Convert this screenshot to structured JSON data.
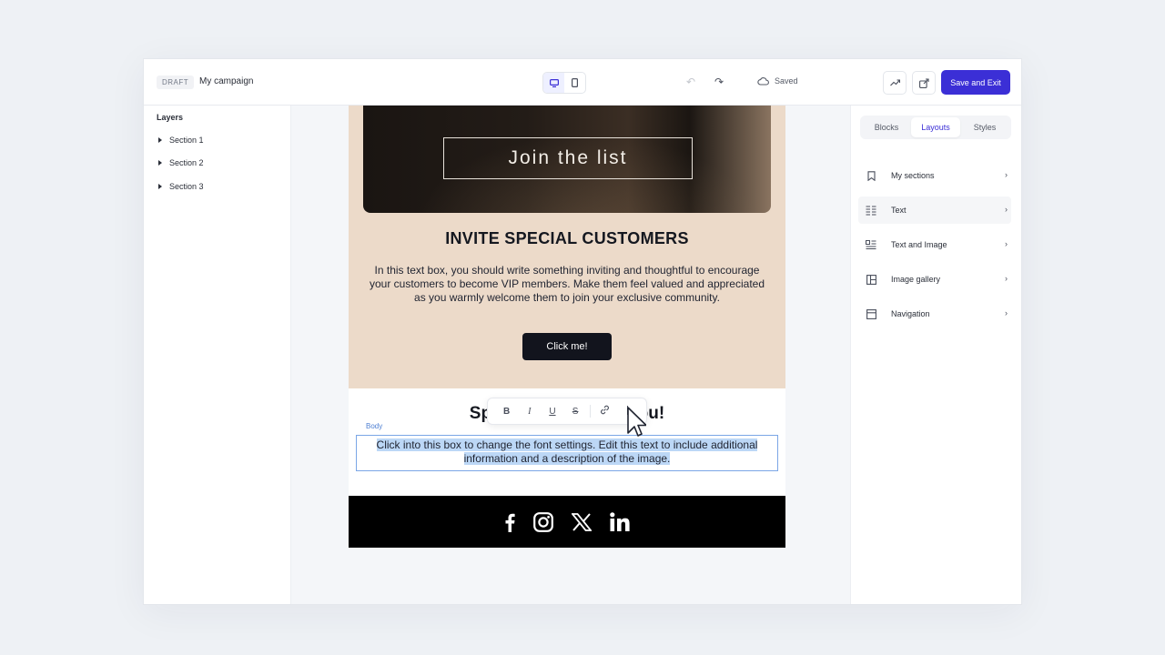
{
  "header": {
    "status_badge": "DRAFT",
    "campaign_name": "My campaign",
    "saved_label": "Saved",
    "save_exit_label": "Save and Exit"
  },
  "layers": {
    "title": "Layers",
    "items": [
      {
        "label": "Section 1"
      },
      {
        "label": "Section 2"
      },
      {
        "label": "Section 3"
      }
    ]
  },
  "email": {
    "hero_banner_text": "Join the list",
    "invite_heading": "INVITE SPECIAL CUSTOMERS",
    "invite_body": "In this text box, you should write something inviting and thoughtful to encourage your customers to become VIP members. Make them feel valued and appreciated as you warmly welcome them to join your exclusive community.",
    "cta_label": "Click me!",
    "second_heading_left": "Spe",
    "second_heading_right": "ou!",
    "selected_block_tag": "Body",
    "selected_text_line1": "Click into this box to change the font settings. Edit this text to include additional",
    "selected_text_line2": "information and a description of the image.",
    "social_icons": [
      "facebook-icon",
      "instagram-icon",
      "x-icon",
      "linkedin-icon"
    ]
  },
  "text_toolbar": {
    "bold": "B",
    "italic": "I",
    "underline": "U",
    "strike": "S"
  },
  "right_panel": {
    "tabs": [
      {
        "label": "Blocks"
      },
      {
        "label": "Layouts",
        "active": true
      },
      {
        "label": "Styles"
      }
    ],
    "layouts": [
      {
        "label": "My sections",
        "icon": "bookmark-icon"
      },
      {
        "label": "Text",
        "icon": "text-lines-icon"
      },
      {
        "label": "Text and Image",
        "icon": "text-image-icon"
      },
      {
        "label": "Image gallery",
        "icon": "gallery-icon"
      },
      {
        "label": "Navigation",
        "icon": "navigation-icon"
      }
    ]
  },
  "colors": {
    "accent": "#3b2fd6",
    "hero_background": "#ecdac9",
    "selection": "#bcd7f6"
  }
}
